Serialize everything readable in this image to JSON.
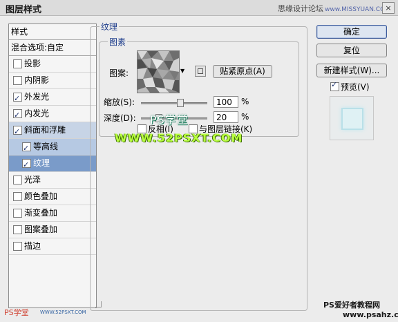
{
  "window": {
    "title": "图层样式",
    "site": "思缘设计论坛",
    "site_url": "www.MISSYUAN.COM",
    "close": "×"
  },
  "sidebar": {
    "header": "样式",
    "blend": "混合选项:自定",
    "items": [
      {
        "label": "投影",
        "checked": false
      },
      {
        "label": "内阴影",
        "checked": false
      },
      {
        "label": "外发光",
        "checked": true
      },
      {
        "label": "内发光",
        "checked": true
      },
      {
        "label": "斜面和浮雕",
        "checked": true
      },
      {
        "label": "等高线",
        "checked": true
      },
      {
        "label": "纹理",
        "checked": true
      },
      {
        "label": "光泽",
        "checked": false
      },
      {
        "label": "颜色叠加",
        "checked": false
      },
      {
        "label": "渐变叠加",
        "checked": false
      },
      {
        "label": "图案叠加",
        "checked": false
      },
      {
        "label": "描边",
        "checked": false
      }
    ]
  },
  "texture": {
    "section_title": "纹理",
    "subsection_title": "图素",
    "pattern_label": "图案:",
    "snap_button": "贴紧原点(A)",
    "scale_label": "缩放(S):",
    "scale_value": "100",
    "scale_level_percent": 100,
    "depth_label": "深度(D):",
    "depth_value": "20",
    "depth_level_percent": 20,
    "percent": "%",
    "invert_label": "反相(I)",
    "link_label": "与图层链接(K)"
  },
  "actions": {
    "ok": "确定",
    "reset": "复位",
    "new_style": "新建样式(W)...",
    "preview": "预览(V)",
    "preview_checked": true
  },
  "watermarks": {
    "ps_hall": "PS学堂",
    "url_52psxt": "WWW.52PSXT.COM",
    "psahz_title": "PS爱好者教程网",
    "psahz_url": "www.psahz.com",
    "footer_ps": "PS学堂",
    "footer_url": "WWW.52PSXT.COM"
  },
  "colors": {
    "selection_main": "#c7d4e6",
    "selection_active": "#7a9bc9",
    "legend_blue": "#1a3a8a",
    "watermark_green": "#b9ff40"
  }
}
